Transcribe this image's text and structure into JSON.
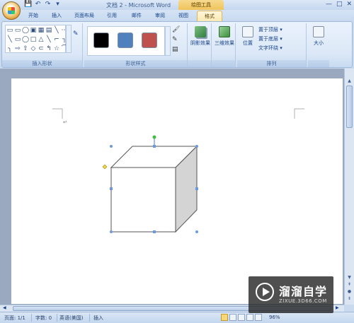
{
  "window": {
    "title": "文档 2 - Microsoft Word",
    "context_tools": "绘图工具",
    "controls": [
      "—",
      "□",
      "✕"
    ]
  },
  "quick_access": [
    "💾",
    "↶",
    "↷",
    "▾"
  ],
  "tabs": [
    {
      "label": "开始"
    },
    {
      "label": "插入"
    },
    {
      "label": "页面布局"
    },
    {
      "label": "引用"
    },
    {
      "label": "邮件"
    },
    {
      "label": "审阅"
    },
    {
      "label": "视图"
    },
    {
      "label": "格式"
    }
  ],
  "ribbon": {
    "insert_shapes": {
      "label": "插入形状",
      "shapes": [
        "▭",
        "▭",
        "◯",
        "▣",
        "▦",
        "▤",
        "╲",
        "⋯",
        "╲",
        "▭",
        "◯",
        "□",
        "△",
        "╲",
        "⌐",
        "┐",
        "╮",
        "⇨",
        "⇧",
        "◇",
        "⊂",
        "↰",
        "☆",
        "⌒"
      ],
      "edit_icon": "✎"
    },
    "shape_styles": {
      "label": "形状样式",
      "swatches": [
        {
          "color": "#000000"
        },
        {
          "color": "#4f81bd"
        },
        {
          "color": "#c0504d"
        }
      ],
      "fill_icons": [
        "🖌",
        "✎",
        "▤"
      ]
    },
    "shadow_effects": {
      "label": "阴影效果"
    },
    "three_d": {
      "label": "三维效果"
    },
    "arrange": {
      "label": "排列",
      "position": "位置",
      "bring_front": "置于顶层 ▾",
      "send_back": "置于底层 ▾",
      "text_wrap": "文字环绕 ▾"
    },
    "size": {
      "label": "大小"
    }
  },
  "document": {
    "paragraph_mark": "↵"
  },
  "statusbar": {
    "page": "页面: 1/1",
    "words": "字数: 0",
    "language": "英语(美国)",
    "mode": "插入",
    "zoom": "96%"
  },
  "watermark": {
    "title": "溜溜自学",
    "subtitle": "ZIXUE.3D66.COM"
  }
}
